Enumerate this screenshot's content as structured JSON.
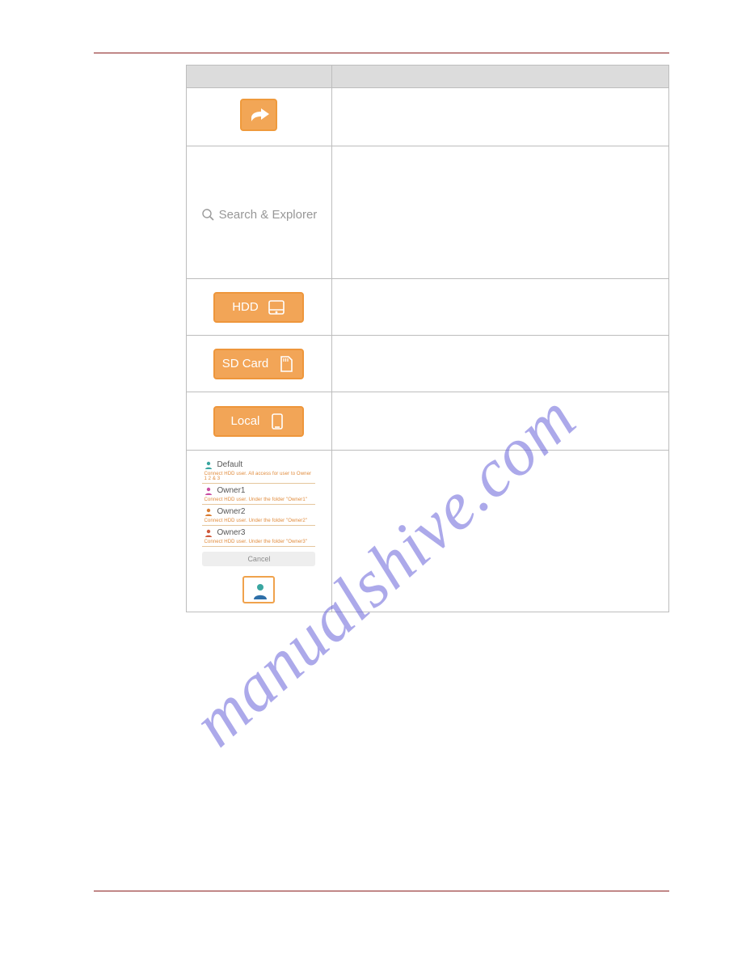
{
  "table": {
    "rows": {
      "search": {
        "label": "Search & Explorer"
      },
      "hdd": {
        "label": "HDD"
      },
      "sd": {
        "label": "SD Card"
      },
      "local": {
        "label": "Local"
      }
    }
  },
  "users": {
    "items": [
      {
        "name": "Default",
        "note": "Connect HDD user. All access for user to Owner 1 2 & 3"
      },
      {
        "name": "Owner1",
        "note": "Connect HDD user. Under the folder \"Owner1\""
      },
      {
        "name": "Owner2",
        "note": "Connect HDD user. Under the folder \"Owner2\""
      },
      {
        "name": "Owner3",
        "note": "Connect HDD user. Under the folder \"Owner3\""
      }
    ],
    "cancel": "Cancel"
  },
  "watermark": "manualshive.com"
}
